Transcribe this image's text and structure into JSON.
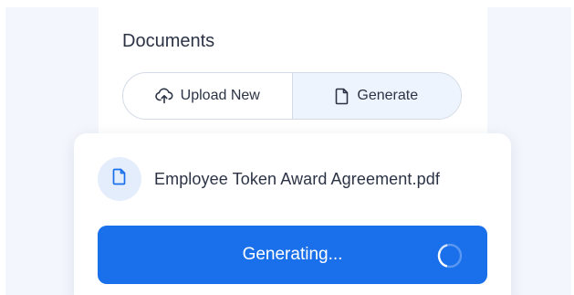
{
  "documents": {
    "title": "Documents",
    "upload_label": "Upload New",
    "generate_label": "Generate"
  },
  "file": {
    "name": "Employee Token Award Agreement.pdf"
  },
  "status": {
    "button_label": "Generating..."
  },
  "icons": {
    "upload": "cloud-upload-icon",
    "generate": "document-icon",
    "file": "file-icon",
    "spinner": "spinner-icon"
  },
  "colors": {
    "accent": "#1a6fea",
    "active_segment_bg": "#eef4fd",
    "file_icon_bg": "#e4edfc",
    "text": "#2b3345"
  }
}
